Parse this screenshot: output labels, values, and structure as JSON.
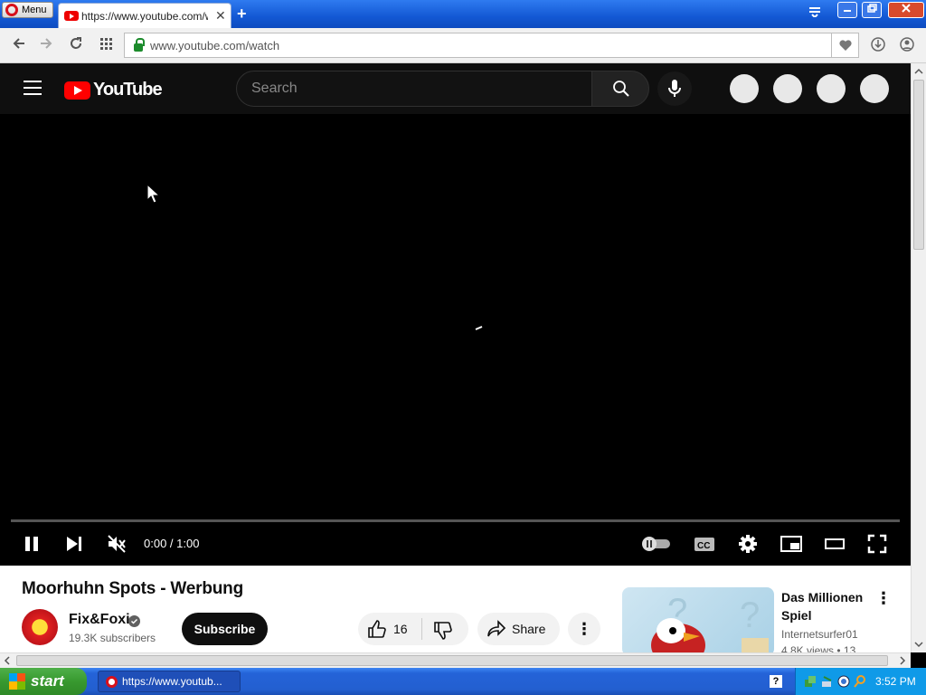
{
  "browser": {
    "menu_label": "Menu",
    "tab_title": "https://www.youtube.com/w",
    "tab_close": "✕",
    "new_tab": "+",
    "url": "www.youtube.com/watch"
  },
  "youtube": {
    "logo_text": "YouTube",
    "search_placeholder": "Search"
  },
  "player": {
    "time": "0:00 / 1:00",
    "progress": 0.0
  },
  "video": {
    "title": "Moorhuhn Spots - Werbung",
    "channel": "Fix&Foxi",
    "subscribers": "19.3K subscribers",
    "subscribe_label": "Subscribe",
    "likes": "16",
    "share_label": "Share"
  },
  "recommendation": {
    "title": "Das Millionen Spiel",
    "channel": "Internetsurfer01",
    "views": "4.8K views • 13"
  },
  "taskbar": {
    "start_label": "start",
    "item_label": "https://www.youtub...",
    "help": "?",
    "clock": "3:52 PM"
  }
}
